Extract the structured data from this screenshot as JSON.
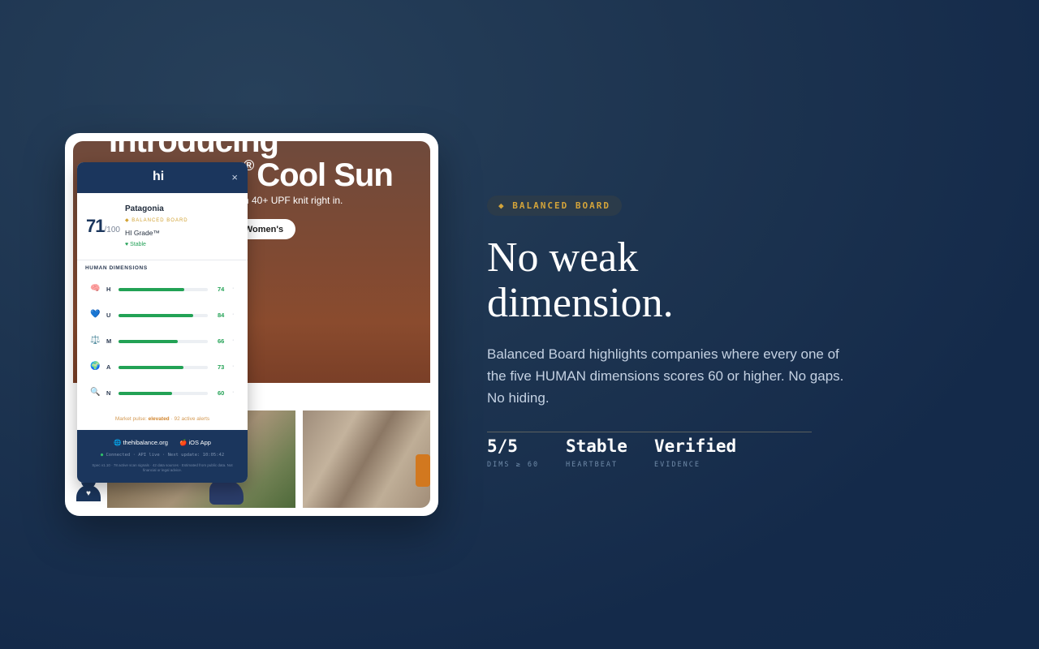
{
  "screenshot": {
    "hero": {
      "title_top": "Introducing",
      "title": "Cool Sun",
      "title_mark": "®",
      "subtitle": "h 40+ UPF knit right in.",
      "button": "Women's"
    },
    "popup": {
      "logo": "hi",
      "close": "×",
      "score": "71",
      "score_max": "/100",
      "company": "Patagonia",
      "board_badge": "◆ BALANCED BOARD",
      "grade": "HI Grade™",
      "status": "♥ Stable",
      "dims_title": "HUMAN DIMENSIONS",
      "dimensions": [
        {
          "icon": "🧠",
          "letter": "H",
          "value": 74
        },
        {
          "icon": "💙",
          "letter": "U",
          "value": 84
        },
        {
          "icon": "⚖️",
          "letter": "M",
          "value": 66
        },
        {
          "icon": "🌍",
          "letter": "A",
          "value": 73
        },
        {
          "icon": "🔍",
          "letter": "N",
          "value": 60
        }
      ],
      "pulse_prefix": "Market pulse: ",
      "pulse_level": "elevated",
      "pulse_suffix": " · 92 active alerts",
      "link_web": "🌐 thehibalance.org",
      "link_app": "🍎 iOS App",
      "status_line": "Connected · API live · Next update: 10:05:42",
      "footnote": "Spec v1.10 · 78 active scan signals · 42 data sources · Estimated from public data. Not financial or legal advice."
    }
  },
  "panel": {
    "badge": "◆ BALANCED BOARD",
    "headline_line1": "No weak",
    "headline_line2": "dimension.",
    "description": "Balanced Board highlights companies where every one of the five HUMAN dimensions scores 60 or higher. No gaps. No hiding.",
    "stats": [
      {
        "value": "5/5",
        "label": "DIMS ≥ 60"
      },
      {
        "value": "Stable",
        "label": "HEARTBEAT"
      },
      {
        "value": "Verified",
        "label": "EVIDENCE"
      }
    ]
  },
  "colors": {
    "accent_gold": "#d4a43a",
    "navy": "#1b365d",
    "good_green": "#22a255"
  }
}
